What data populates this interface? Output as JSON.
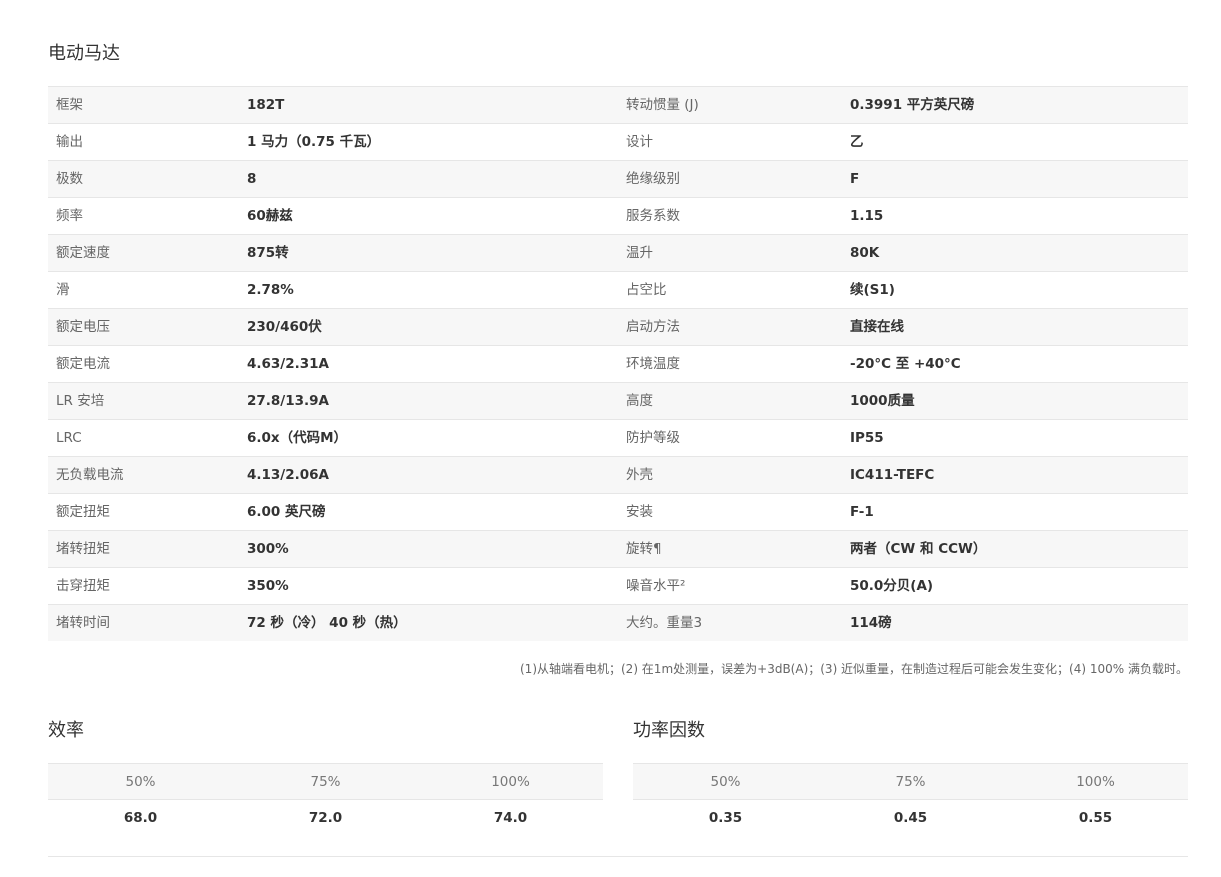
{
  "title": "电动马达",
  "specs": [
    {
      "l1": "框架",
      "v1": "182T",
      "l2": "转动惯量 (J)",
      "v2": "0.3991 平方英尺磅"
    },
    {
      "l1": "输出",
      "v1": "1 马力（0.75 千瓦）",
      "l2": "设计",
      "v2": "乙"
    },
    {
      "l1": "极数",
      "v1": "8",
      "l2": "绝缘级别",
      "v2": "F"
    },
    {
      "l1": "频率",
      "v1": "60赫兹",
      "l2": "服务系数",
      "v2": "1.15"
    },
    {
      "l1": "额定速度",
      "v1": "875转",
      "l2": "温升",
      "v2": "80K"
    },
    {
      "l1": "滑",
      "v1": "2.78%",
      "l2": "占空比",
      "v2": "续(S1)"
    },
    {
      "l1": "额定电压",
      "v1": "230/460伏",
      "l2": "启动方法",
      "v2": "直接在线"
    },
    {
      "l1": "额定电流",
      "v1": "4.63/2.31A",
      "l2": "环境温度",
      "v2": "-20°C 至 +40°C"
    },
    {
      "l1": "LR 安培",
      "v1": "27.8/13.9A",
      "l2": "高度",
      "v2": "1000质量"
    },
    {
      "l1": "LRC",
      "v1": "6.0x（代码M）",
      "l2": "防护等级",
      "v2": "IP55"
    },
    {
      "l1": "无负载电流",
      "v1": "4.13/2.06A",
      "l2": "外壳",
      "v2": "IC411-TEFC"
    },
    {
      "l1": "额定扭矩",
      "v1": "6.00 英尺磅",
      "l2": "安装",
      "v2": "F-1"
    },
    {
      "l1": "堵转扭矩",
      "v1": "300%",
      "l2": "旋转¶",
      "v2": "两者（CW 和 CCW）"
    },
    {
      "l1": "击穿扭矩",
      "v1": "350%",
      "l2": "噪音水平²",
      "v2": "50.0分贝(A)"
    },
    {
      "l1": "堵转时间",
      "v1": "72 秒（冷） 40 秒（热）",
      "l2": "大约。重量3",
      "v2": "114磅"
    }
  ],
  "footnote": "(1)从轴端看电机；(2) 在1m处测量，误差为+3dB(A)；(3) 近似重量，在制造过程后可能会发生变化；(4) 100% 满负载时。",
  "efficiency": {
    "title": "效率",
    "headers": [
      "50%",
      "75%",
      "100%"
    ],
    "values": [
      "68.0",
      "72.0",
      "74.0"
    ]
  },
  "power_factor": {
    "title": "功率因数",
    "headers": [
      "50%",
      "75%",
      "100%"
    ],
    "values": [
      "0.35",
      "0.45",
      "0.55"
    ]
  }
}
